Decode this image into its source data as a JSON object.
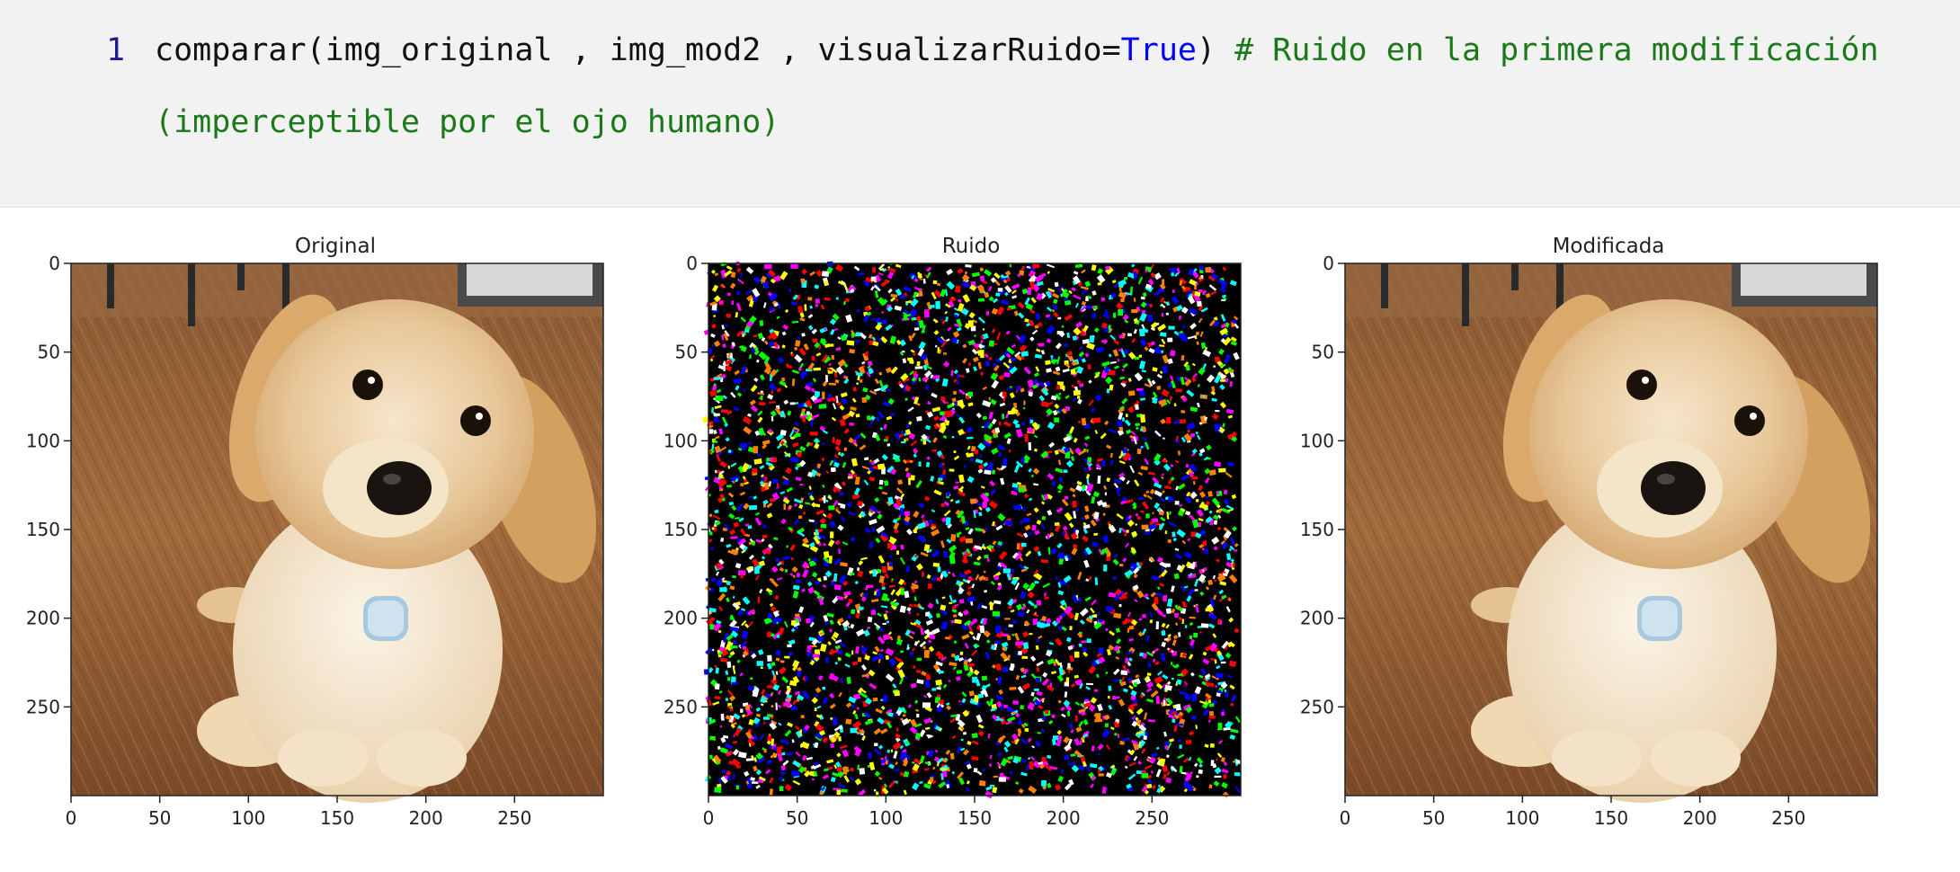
{
  "code_cell": {
    "line_number": "1",
    "function_call": "comparar(img_original , img_mod2 , visualizarRuido=",
    "keyword": "True",
    "closing_paren": ") ",
    "comment_line1": "# Ruido en la primera modificación",
    "comment_line2": "(imperceptible por el ojo humano)"
  },
  "figure": {
    "panels": [
      {
        "title": "Original",
        "content": "puppy-photo"
      },
      {
        "title": "Ruido",
        "content": "noise-image"
      },
      {
        "title": "Modificada",
        "content": "puppy-photo"
      }
    ],
    "x_ticks": [
      "0",
      "50",
      "100",
      "150",
      "200",
      "250"
    ],
    "y_ticks": [
      "0",
      "50",
      "100",
      "150",
      "200",
      "250"
    ]
  },
  "colors": {
    "code_background": "#f2f2f2",
    "keyword": "#0000ff",
    "comment": "#1a7a1a",
    "noise_palette": [
      "#ff0000",
      "#00ff00",
      "#0000ff",
      "#ffff00",
      "#ff00ff",
      "#00ffff",
      "#ffffff",
      "#ff8000"
    ]
  }
}
